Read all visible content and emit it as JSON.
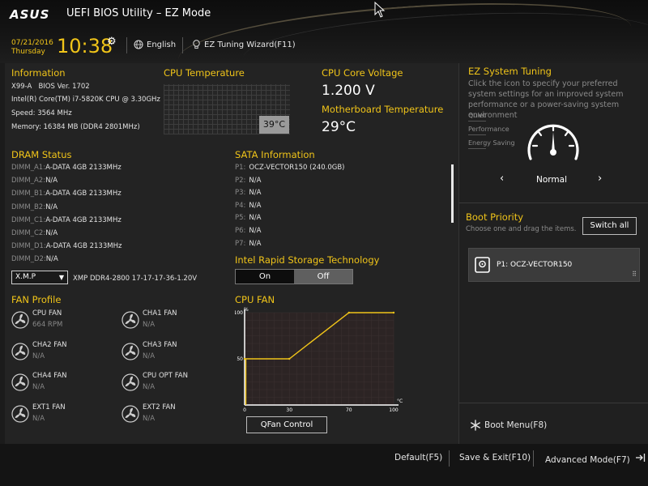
{
  "header": {
    "logo": "ASUS",
    "title": "UEFI BIOS Utility – EZ Mode",
    "date": "07/21/2016",
    "day": "Thursday",
    "time": "10:38",
    "language": "English",
    "ez_tuning_wizard": "EZ Tuning Wizard(F11)"
  },
  "information": {
    "title": "Information",
    "model": "X99-A",
    "bios": "BIOS Ver. 1702",
    "cpu": "Intel(R) Core(TM) i7-5820K CPU @ 3.30GHz",
    "speed": "Speed: 3564 MHz",
    "memory": "Memory: 16384 MB (DDR4 2801MHz)"
  },
  "cpu_temperature": {
    "title": "CPU Temperature",
    "value": "39°C"
  },
  "cpu_core_voltage": {
    "title": "CPU Core Voltage",
    "value": "1.200 V"
  },
  "motherboard_temperature": {
    "title": "Motherboard Temperature",
    "value": "29°C"
  },
  "dram_status": {
    "title": "DRAM Status",
    "slots": [
      {
        "label": "DIMM_A1:",
        "value": "A-DATA 4GB 2133MHz"
      },
      {
        "label": "DIMM_A2:",
        "value": "N/A"
      },
      {
        "label": "DIMM_B1:",
        "value": "A-DATA 4GB 2133MHz"
      },
      {
        "label": "DIMM_B2:",
        "value": "N/A"
      },
      {
        "label": "DIMM_C1:",
        "value": "A-DATA 4GB 2133MHz"
      },
      {
        "label": "DIMM_C2:",
        "value": "N/A"
      },
      {
        "label": "DIMM_D1:",
        "value": "A-DATA 4GB 2133MHz"
      },
      {
        "label": "DIMM_D2:",
        "value": "N/A"
      }
    ],
    "xmp_selected": "X.M.P",
    "xmp_profile": "XMP DDR4-2800 17-17-17-36-1.20V"
  },
  "sata_information": {
    "title": "SATA Information",
    "ports": [
      {
        "label": "P1:",
        "value": "OCZ-VECTOR150 (240.0GB)"
      },
      {
        "label": "P2:",
        "value": "N/A"
      },
      {
        "label": "P3:",
        "value": "N/A"
      },
      {
        "label": "P4:",
        "value": "N/A"
      },
      {
        "label": "P5:",
        "value": "N/A"
      },
      {
        "label": "P6:",
        "value": "N/A"
      },
      {
        "label": "P7:",
        "value": "N/A"
      }
    ]
  },
  "intel_rst": {
    "title": "Intel Rapid Storage Technology",
    "on_label": "On",
    "off_label": "Off",
    "selected": "Off"
  },
  "fan_profile": {
    "title": "FAN Profile",
    "fans": [
      {
        "name": "CPU FAN",
        "value": "664 RPM"
      },
      {
        "name": "CHA1 FAN",
        "value": "N/A"
      },
      {
        "name": "CHA2 FAN",
        "value": "N/A"
      },
      {
        "name": "CHA3 FAN",
        "value": "N/A"
      },
      {
        "name": "CHA4 FAN",
        "value": "N/A"
      },
      {
        "name": "CPU OPT FAN",
        "value": "N/A"
      },
      {
        "name": "EXT1 FAN",
        "value": "N/A"
      },
      {
        "name": "EXT2 FAN",
        "value": "N/A"
      }
    ]
  },
  "cpu_fan": {
    "title": "CPU FAN",
    "y_unit": "%",
    "x_unit": "°C",
    "x_ticks": [
      "0",
      "30",
      "70",
      "100"
    ],
    "y_ticks": [
      "100",
      "50"
    ],
    "curve_points": [
      [
        0,
        50
      ],
      [
        30,
        50
      ],
      [
        70,
        100
      ],
      [
        100,
        100
      ]
    ],
    "qfan_label": "QFan Control",
    "accent": "#f0c419"
  },
  "ez_system_tuning": {
    "title": "EZ System Tuning",
    "description": "Click the icon to specify your preferred system settings for an improved system performance or a power-saving system environment",
    "options": [
      "Quiet",
      "Performance",
      "Energy Saving"
    ],
    "mode": "Normal"
  },
  "boot_priority": {
    "title": "Boot Priority",
    "description": "Choose one and drag the items.",
    "switch_all": "Switch all",
    "items": [
      {
        "label": "P1: OCZ-VECTOR150"
      }
    ]
  },
  "boot_menu": {
    "label": "Boot Menu(F8)"
  },
  "footer": {
    "default": "Default(F5)",
    "save_exit": "Save & Exit(F10)",
    "advanced_mode": "Advanced Mode(F7)"
  }
}
